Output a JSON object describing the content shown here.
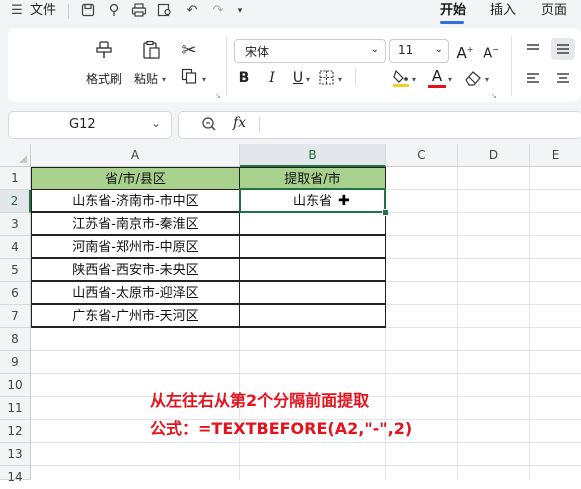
{
  "titlebar": {
    "menu_label": "文件",
    "tabs": [
      "开始",
      "插入",
      "页面"
    ]
  },
  "ribbon": {
    "format_painter": "格式刷",
    "paste": "粘贴",
    "font_name": "宋体",
    "font_size": "11"
  },
  "formula_bar": {
    "name_box": "G12",
    "fx": "fx",
    "value": ""
  },
  "sheet": {
    "columns": [
      "A",
      "B",
      "C",
      "D",
      "E"
    ],
    "rows": [
      "1",
      "2",
      "3",
      "4",
      "5",
      "6",
      "7",
      "8",
      "9",
      "10",
      "11",
      "12",
      "13",
      "14"
    ],
    "header_a": "省/市/县区",
    "header_b": "提取省/市",
    "data_a": [
      "山东省-济南市-市中区",
      "江苏省-南京市-秦淮区",
      "河南省-郑州市-中原区",
      "陕西省-西安市-未央区",
      "山西省-太原市-迎泽区",
      "广东省-广州市-天河区"
    ],
    "data_b": [
      "山东省",
      "",
      "",
      "",
      "",
      ""
    ],
    "active_cell": "B2"
  },
  "annotation": {
    "line1": "从左往右从第2个分隔前面提取",
    "line2": "公式：=TEXTBEFORE(A2,\"-\",2)"
  },
  "colors": {
    "header_fill": "#a9d18e",
    "accent": "#2f6fe0",
    "active_border": "#217346",
    "note_red": "#e5121b"
  }
}
